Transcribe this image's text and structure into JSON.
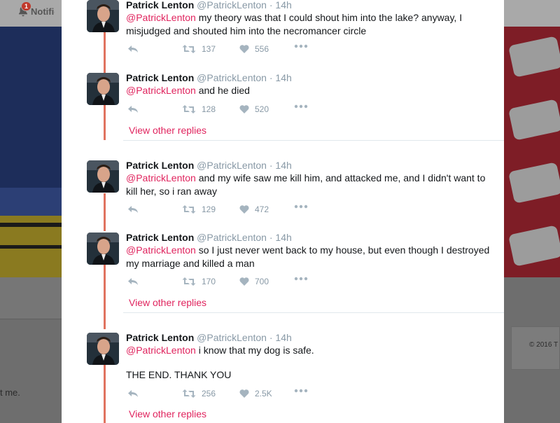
{
  "background": {
    "notifications_label": "Notifications",
    "notifications_count": "1",
    "copyright": "© 2016 T",
    "partial_text": "t me."
  },
  "tweets": [
    {
      "name": "Patrick Lenton",
      "handle": "@PatrickLenton",
      "sep": "·",
      "time": "14h",
      "mention": "@PatrickLenton",
      "text": " my theory was that I could shout him into the lake? anyway, I misjudged and shouted him into the necromancer circle",
      "retweets": "137",
      "likes": "556"
    },
    {
      "name": "Patrick Lenton",
      "handle": "@PatrickLenton",
      "sep": "·",
      "time": "14h",
      "mention": "@PatrickLenton",
      "text": " and he died",
      "retweets": "128",
      "likes": "520",
      "view_other_replies": "View other replies"
    },
    {
      "name": "Patrick Lenton",
      "handle": "@PatrickLenton",
      "sep": "·",
      "time": "14h",
      "mention": "@PatrickLenton",
      "text": " and my wife saw me kill him, and attacked me, and I didn't want to kill her, so i ran away",
      "retweets": "129",
      "likes": "472"
    },
    {
      "name": "Patrick Lenton",
      "handle": "@PatrickLenton",
      "sep": "·",
      "time": "14h",
      "mention": "@PatrickLenton",
      "text": " so I just never went back to my house, but even though I destroyed my marriage and killed a man",
      "retweets": "170",
      "likes": "700",
      "view_other_replies": "View other replies"
    },
    {
      "name": "Patrick Lenton",
      "handle": "@PatrickLenton",
      "sep": "·",
      "time": "14h",
      "mention": "@PatrickLenton",
      "text": " i know that my dog is safe.",
      "text2": "THE END. THANK YOU",
      "retweets": "256",
      "likes": "2.5K",
      "view_other_replies": "View other replies"
    }
  ],
  "colors": {
    "mention": "#e0245e",
    "thread_line": "#e0735f",
    "meta_gray": "#8899a6"
  },
  "icons": [
    "bell-icon",
    "reply-icon",
    "retweet-icon",
    "heart-icon",
    "more-icon"
  ]
}
